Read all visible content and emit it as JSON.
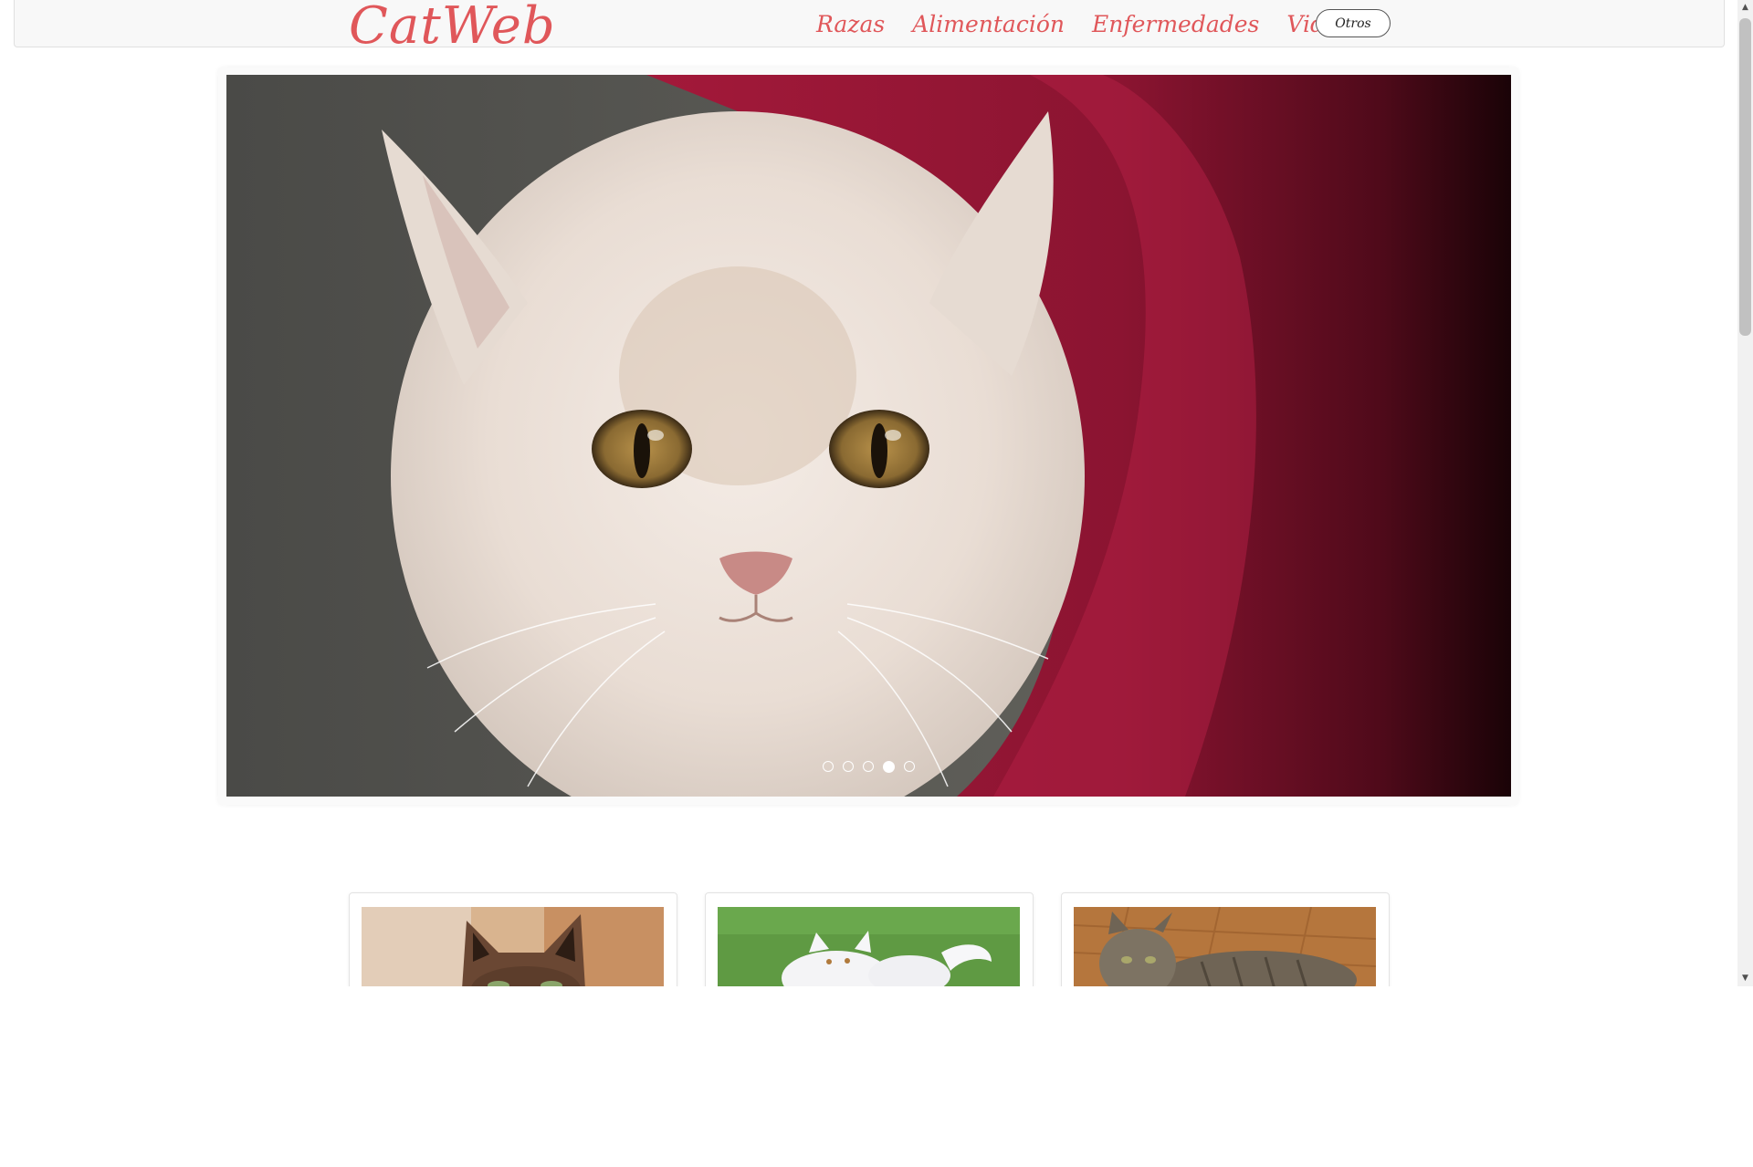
{
  "navbar": {
    "brand": "CatWeb",
    "links": [
      "Razas",
      "Alimentación",
      "Enfermedades",
      "Videos"
    ],
    "otros_label": "Otros"
  },
  "carousel": {
    "slide_count": 5,
    "active_index": 3
  },
  "colors": {
    "brand": "#e0575a",
    "navbar_bg": "#f8f8f8",
    "curtain": "#8e1530"
  }
}
